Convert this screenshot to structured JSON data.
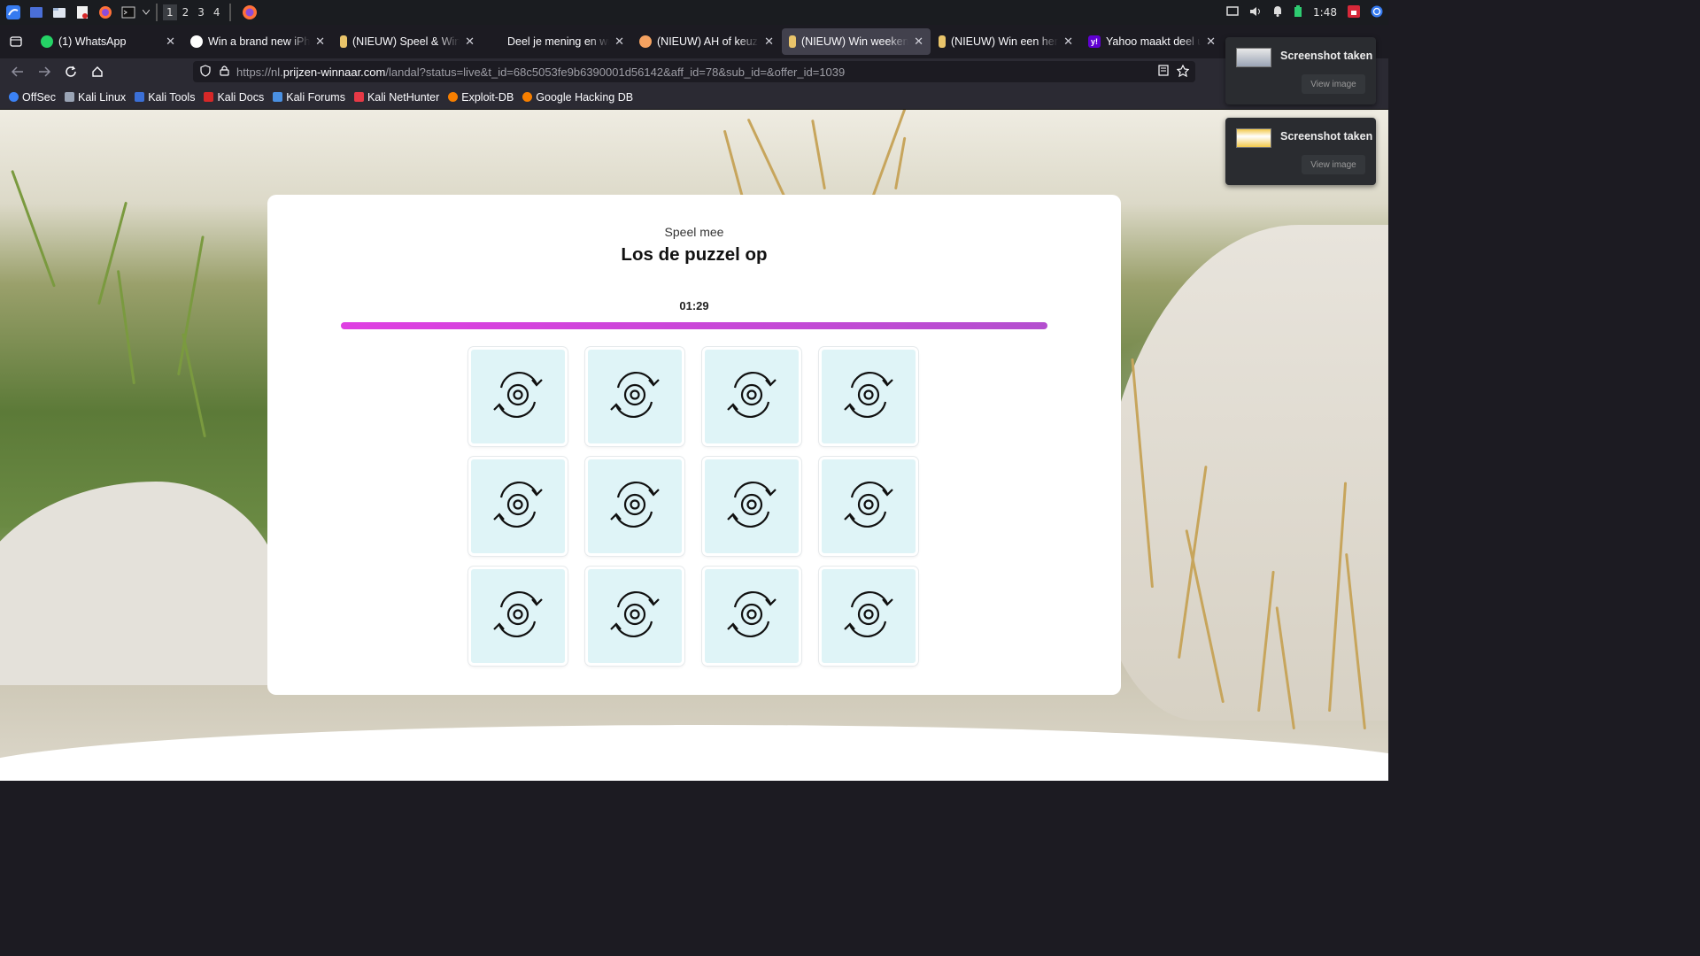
{
  "panel": {
    "workspaces": [
      "1",
      "2",
      "3",
      "4"
    ],
    "clock": "1:48"
  },
  "tabs": [
    {
      "title": "(1) WhatsApp",
      "favicon": "whatsapp-icon",
      "color": "#25d366",
      "active": false
    },
    {
      "title": "Win a brand new iPhone",
      "favicon": "apple-icon",
      "color": "#ffffff",
      "active": false
    },
    {
      "title": "(NIEUW) Speel & Win",
      "favicon": "ice-cream-icon",
      "color": "#e9c46a",
      "active": false
    },
    {
      "title": "Deel je mening en win",
      "favicon": "",
      "color": "#1c1b22",
      "active": false
    },
    {
      "title": "(NIEUW) AH of keuze",
      "favicon": "emoji-icon",
      "color": "#f4a261",
      "active": false
    },
    {
      "title": "(NIEUW) Win weekend",
      "favicon": "ice-cream-icon",
      "color": "#e9c46a",
      "active": true
    },
    {
      "title": "(NIEUW) Win een hem",
      "favicon": "ice-cream-icon",
      "color": "#e9c46a",
      "active": false
    },
    {
      "title": "Yahoo maakt deel uit v",
      "favicon": "yahoo-icon",
      "color": "#6001d2",
      "active": false
    }
  ],
  "url": {
    "prefix": "https://nl.",
    "domain": "prijzen-winnaar.com",
    "rest": "/landal?status=live&t_id=68c5053fe9b6390001d56142&aff_id=78&sub_id=&offer_id=1039"
  },
  "bookmarks": [
    {
      "label": "OffSec",
      "color": "#3b82f6"
    },
    {
      "label": "Kali Linux",
      "color": "#9aa4b5"
    },
    {
      "label": "Kali Tools",
      "color": "#3b6fd6"
    },
    {
      "label": "Kali Docs",
      "color": "#d62828"
    },
    {
      "label": "Kali Forums",
      "color": "#4a90e2"
    },
    {
      "label": "Kali NetHunter",
      "color": "#e63946"
    },
    {
      "label": "Exploit-DB",
      "color": "#f77f00"
    },
    {
      "label": "Google Hacking DB",
      "color": "#f77f00"
    }
  ],
  "game": {
    "subtitle": "Speel mee",
    "title": "Los de puzzel op",
    "timer": "01:29",
    "progress": 1.0,
    "tile_count": 12,
    "tile_icon": "card-flip-icon"
  },
  "notifications": [
    {
      "title": "Screenshot taken",
      "button": "View image"
    },
    {
      "title": "Screenshot taken",
      "button": "View image"
    }
  ]
}
